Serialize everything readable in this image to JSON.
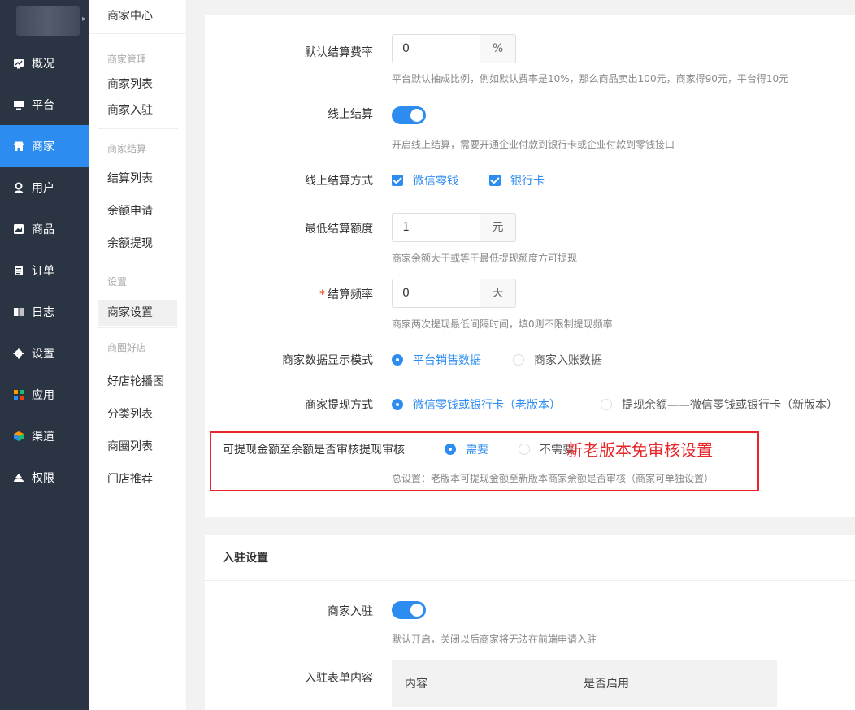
{
  "sidebar": {
    "items": [
      {
        "label": "概况",
        "icon": "chart-icon"
      },
      {
        "label": "平台",
        "icon": "monitor-icon"
      },
      {
        "label": "商家",
        "icon": "store-icon",
        "active": true
      },
      {
        "label": "用户",
        "icon": "user-icon"
      },
      {
        "label": "商品",
        "icon": "goods-icon"
      },
      {
        "label": "订单",
        "icon": "order-icon"
      },
      {
        "label": "日志",
        "icon": "log-icon"
      },
      {
        "label": "设置",
        "icon": "gear-icon"
      },
      {
        "label": "应用",
        "icon": "apps-icon"
      },
      {
        "label": "渠道",
        "icon": "channel-icon"
      },
      {
        "label": "权限",
        "icon": "lock-icon"
      }
    ],
    "active_color": "#2d8cf0",
    "bg_color": "#2b3443"
  },
  "submenu": {
    "title": "商家中心",
    "groups": [
      {
        "label": "商家管理",
        "items": [
          "商家列表",
          "商家入驻"
        ]
      },
      {
        "label": "商家结算",
        "items": [
          "结算列表",
          "余额申请",
          "余额提现"
        ]
      },
      {
        "label": "设置",
        "items": [
          "商家设置"
        ]
      },
      {
        "label": "商圈好店",
        "items": [
          "好店轮播图",
          "分类列表",
          "商圈列表",
          "门店推荐"
        ]
      }
    ],
    "active_item": "商家设置"
  },
  "settlement": {
    "rate": {
      "label": "默认结算费率",
      "value": "0",
      "unit": "%",
      "hint": "平台默认抽成比例，例如默认费率是10%，那么商品卖出100元，商家得90元，平台得10元"
    },
    "online": {
      "label": "线上结算",
      "on": true,
      "hint": "开启线上结算，需要开通企业付款到银行卡或企业付款到零钱接口"
    },
    "method": {
      "label": "线上结算方式",
      "options": [
        "微信零钱",
        "银行卡"
      ]
    },
    "min_amount": {
      "label": "最低结算额度",
      "value": "1",
      "unit": "元",
      "hint": "商家余额大于或等于最低提现额度方可提现"
    },
    "frequency": {
      "label": "结算频率",
      "required_mark": "*",
      "value": "0",
      "unit": "天",
      "hint": "商家两次提现最低间隔时间，填0则不限制提现频率"
    },
    "display_mode": {
      "label": "商家数据显示模式",
      "selected": "平台销售数据",
      "other": "商家入账数据"
    },
    "withdraw_method": {
      "label": "商家提现方式",
      "selected": "微信零钱或银行卡（老版本）",
      "other": "提现余额——微信零钱或银行卡（新版本）"
    },
    "audit": {
      "label": "可提现金额至余额是否审核提现审核",
      "selected": "需要",
      "other": "不需要",
      "hint": "总设置：老版本可提现金额至新版本商家余额是否审核（商家可单独设置）"
    }
  },
  "annotation": "新老版本免审核设置",
  "settle_in": {
    "title": "入驻设置",
    "switch": {
      "label": "商家入驻",
      "on": true,
      "hint": "默认开启，关闭以后商家将无法在前端申请入驻"
    },
    "form": {
      "label": "入驻表单内容",
      "columns": [
        "内容",
        "是否启用"
      ]
    }
  }
}
